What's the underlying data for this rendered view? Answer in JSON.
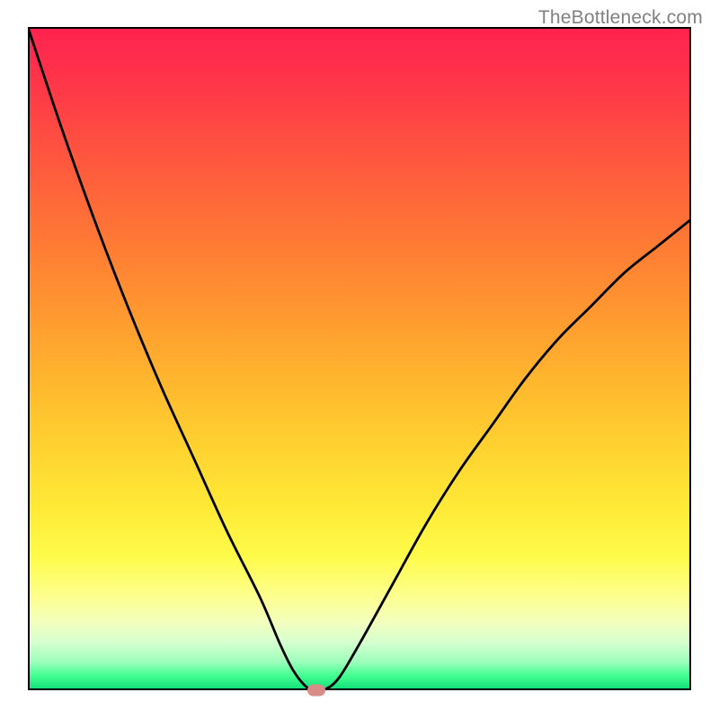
{
  "watermark": "TheBottleneck.com",
  "chart_data": {
    "type": "line",
    "title": "",
    "xlabel": "",
    "ylabel": "",
    "xlim": [
      0,
      100
    ],
    "ylim": [
      0,
      100
    ],
    "series": [
      {
        "name": "bottleneck-curve",
        "x_y_points": [
          [
            0,
            100
          ],
          [
            5,
            85
          ],
          [
            10,
            71
          ],
          [
            15,
            58
          ],
          [
            20,
            46
          ],
          [
            25,
            35
          ],
          [
            30,
            24
          ],
          [
            35,
            14
          ],
          [
            38,
            7
          ],
          [
            40,
            3
          ],
          [
            42,
            0.5
          ],
          [
            43.5,
            0
          ],
          [
            45,
            0.2
          ],
          [
            47,
            2
          ],
          [
            50,
            7
          ],
          [
            55,
            16
          ],
          [
            60,
            25
          ],
          [
            65,
            33
          ],
          [
            70,
            40
          ],
          [
            75,
            47
          ],
          [
            80,
            53
          ],
          [
            85,
            58
          ],
          [
            90,
            63
          ],
          [
            95,
            67
          ],
          [
            100,
            71
          ]
        ]
      }
    ],
    "marker": {
      "x": 43.5,
      "y": 0,
      "color": "#d98d87"
    },
    "background_gradient": {
      "top": "#ff2350",
      "mid": "#ffe836",
      "bottom": "#13e279"
    }
  }
}
